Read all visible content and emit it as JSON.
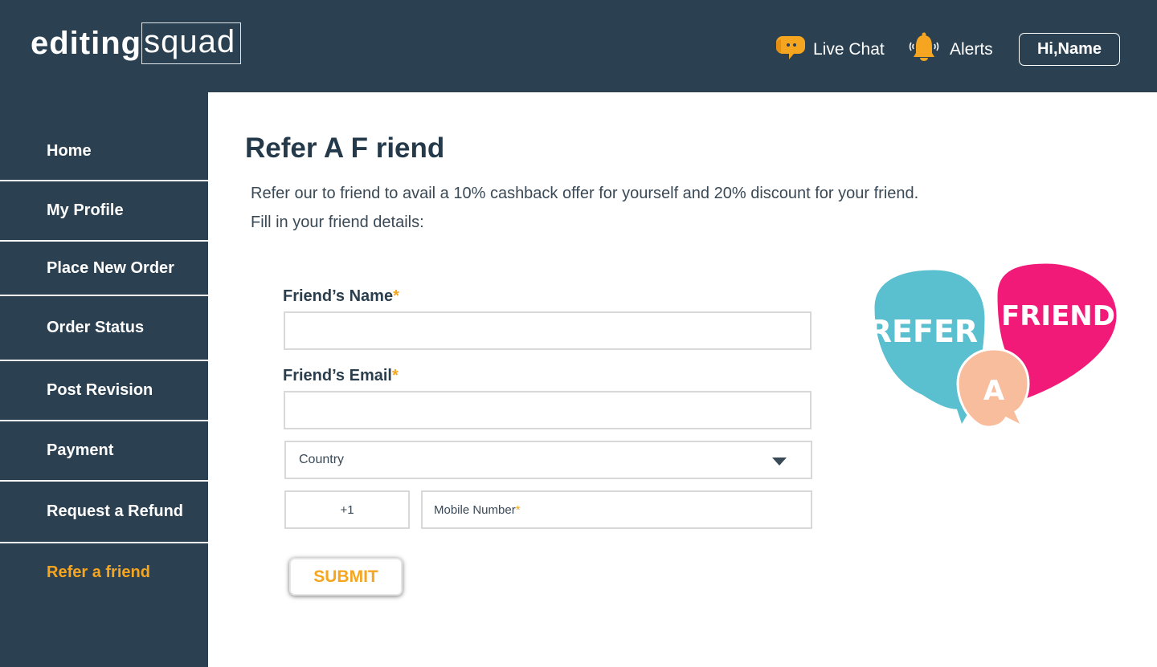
{
  "brand": {
    "logo_part1": "editing",
    "logo_part2": "squad"
  },
  "header": {
    "live_chat_label": "Live Chat",
    "alerts_label": "Alerts",
    "user_button_label": "Hi,Name"
  },
  "sidebar": {
    "items": [
      {
        "label": "Home"
      },
      {
        "label": "My Profile"
      },
      {
        "label": "Place New Order"
      },
      {
        "label": "Order Status"
      },
      {
        "label": "Post Revision"
      },
      {
        "label": "Payment"
      },
      {
        "label": "Request a Refund"
      },
      {
        "label": "Refer a friend",
        "active": true
      }
    ]
  },
  "main": {
    "title": "Refer A F riend",
    "intro_line1": "Refer our to friend to avail a 10% cashback offer for yourself and 20% discount for your friend.",
    "intro_line2": "Fill in your friend details:",
    "form": {
      "name_label": "Friend’s Name",
      "email_label": "Friend’s Email",
      "required_mark": "*",
      "name_value": "",
      "email_value": "",
      "country_label": "Country",
      "country_code": "+1",
      "mobile_label": "Mobile Number",
      "submit_label": "SUBMIT"
    },
    "illustration": {
      "word1": "REFER",
      "word2": "A",
      "word3": "FRIEND"
    }
  },
  "colors": {
    "header_bg": "#2b4152",
    "accent": "#f5a51f",
    "bubble_teal": "#5abfcf",
    "bubble_pink": "#f11a78",
    "bubble_peach": "#f8bd9d"
  },
  "icons": [
    "chat-bubble-icon",
    "bell-icon",
    "chevron-down-icon"
  ]
}
